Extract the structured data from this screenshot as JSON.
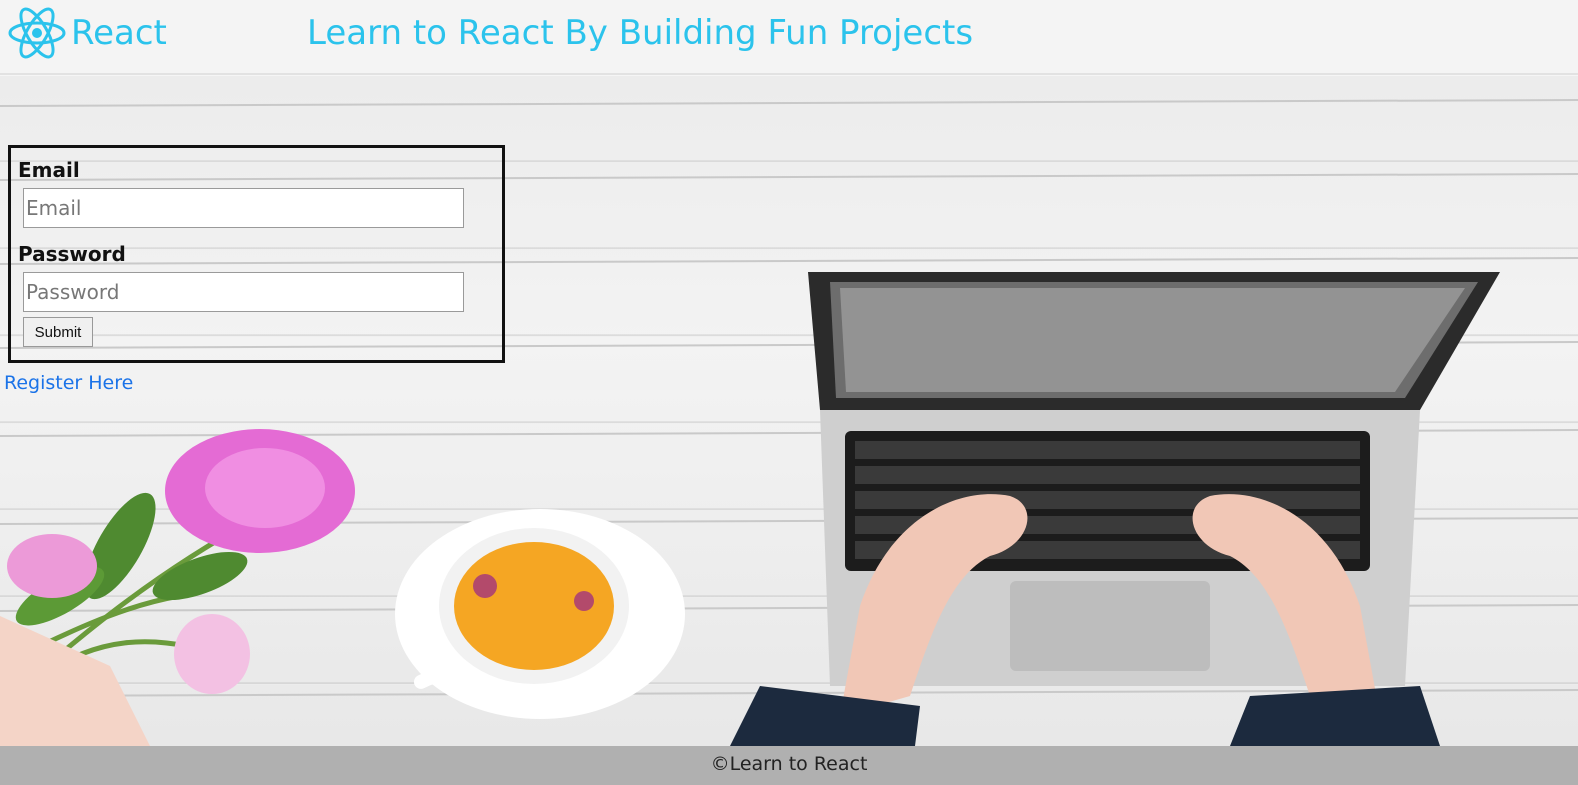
{
  "header": {
    "brand": "React",
    "title": "Learn to React By Building Fun Projects",
    "accent_color": "#2bc3ec",
    "logo_icon": "react-atom-icon"
  },
  "login_form": {
    "email_label": "Email",
    "email_placeholder": "Email",
    "email_value": "",
    "password_label": "Password",
    "password_placeholder": "Password",
    "password_value": "",
    "submit_label": "Submit"
  },
  "register_link": "Register Here",
  "footer": {
    "text": "©Learn to React"
  }
}
